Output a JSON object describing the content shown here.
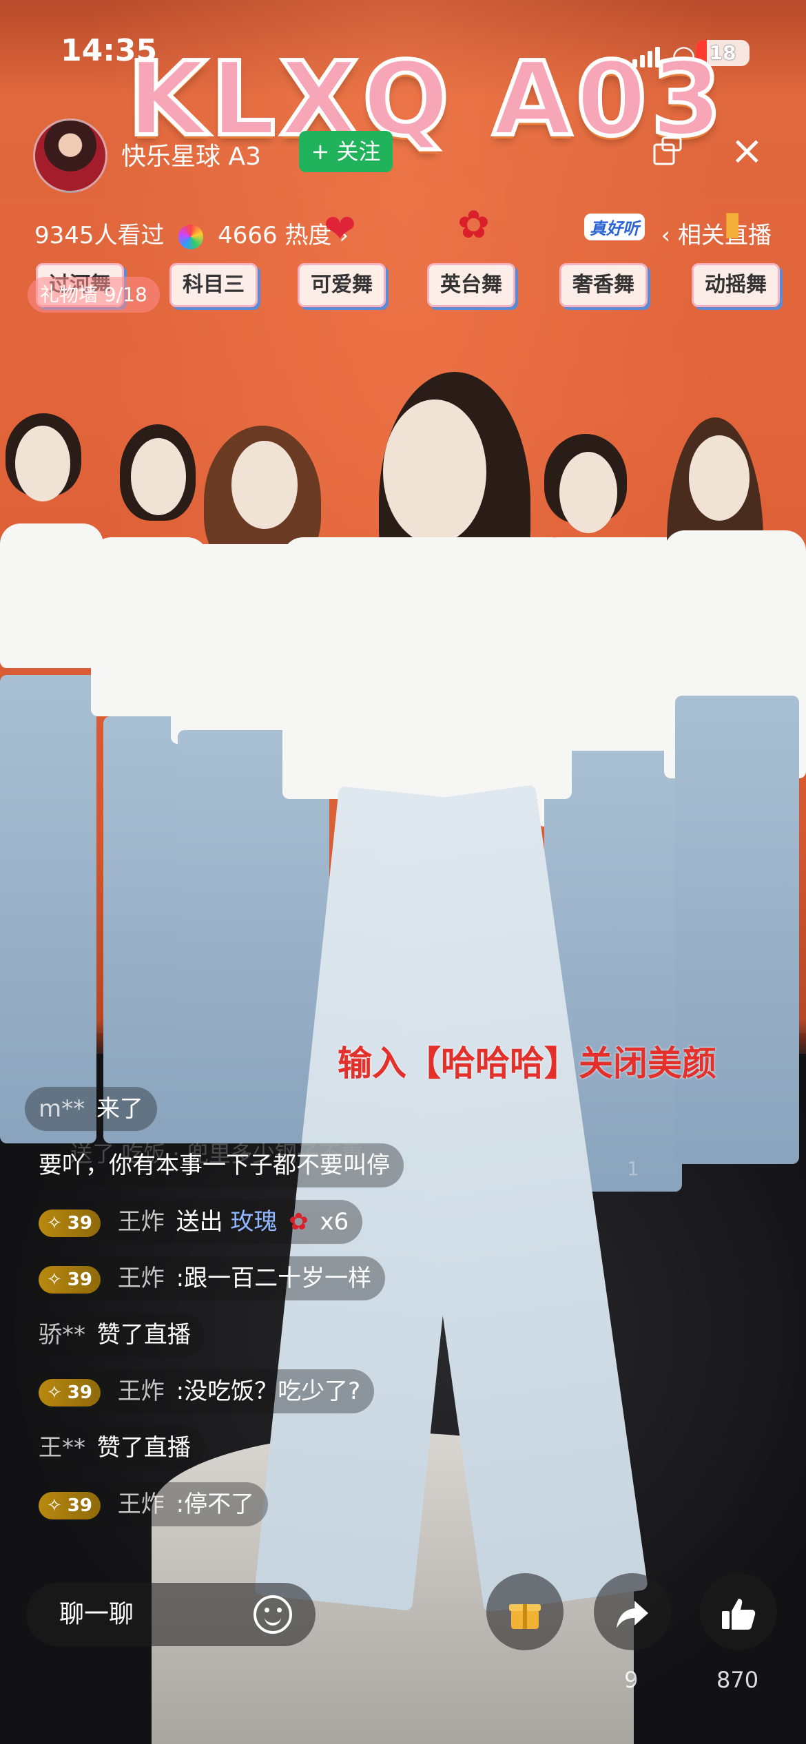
{
  "status_bar": {
    "time": "14:35",
    "battery": "18"
  },
  "banner": {
    "text": "KLXQ A03"
  },
  "header": {
    "anchor_name": "快乐星球 A3",
    "follow_label": "+ 关注",
    "viewers": "9345人看过",
    "heat": "4666 热度",
    "heat_arrow": "›",
    "related_live": "‹ 相关直播",
    "badge_text": "真好听"
  },
  "dance_tags": [
    "过河舞",
    "科目三",
    "可爱舞",
    "英台舞",
    "奢香舞",
    "动摇舞"
  ],
  "gift_wall": "礼物墙 9/18",
  "overlay_caption": "输入【哈哈哈】关闭美颜",
  "ghost_message": "… 送了 吃饭 · 兜里多少钢子不重",
  "ghost_like": "1",
  "chat": [
    {
      "user": "m**",
      "text": "来了",
      "badge": ""
    },
    {
      "user": "",
      "text": "要吖，你有本事一下子都不要叫停",
      "badge": ""
    },
    {
      "user": "王炸",
      "text_prefix": "送出",
      "gift": "玫瑰",
      "suffix": "x6",
      "badge": "39"
    },
    {
      "user": "王炸",
      "text": ":跟一百二十岁一样",
      "badge": "39"
    },
    {
      "user": "骄**",
      "text": "赞了直播",
      "badge": ""
    },
    {
      "user": "王炸",
      "text": ":没吃饭？吃少了?",
      "badge": "39"
    },
    {
      "user": "王**",
      "text": "赞了直播",
      "badge": ""
    },
    {
      "user": "王炸",
      "text": ":停不了",
      "badge": "39"
    }
  ],
  "bottom_bar": {
    "chat_placeholder": "聊一聊",
    "share_count": "9",
    "like_count": "870"
  },
  "icons": {
    "close": "close-icon",
    "screen": "screen-rotate-icon",
    "emoji": "emoji-icon",
    "gift": "gift-icon",
    "share": "share-icon",
    "like": "thumbs-up-icon",
    "heart": "heart-icon",
    "rose": "rose-icon"
  },
  "colors": {
    "follow": "#21b35b",
    "accent_red": "#e4302a",
    "badge_gold": "#b8890f"
  }
}
